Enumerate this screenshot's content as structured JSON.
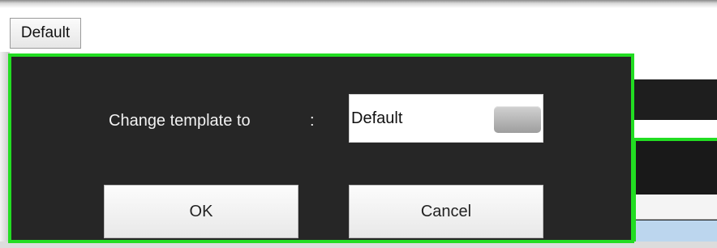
{
  "toolbar": {
    "template_button_label": "Default"
  },
  "dialog": {
    "label": "Change template to",
    "separator": ":",
    "selected_template": "Default",
    "ok_label": "OK",
    "cancel_label": "Cancel"
  },
  "colors": {
    "dialog_background": "#262626",
    "dialog_border": "#22dd22",
    "button_face": "#f0f0f0",
    "selection_row": "#bcd6ee"
  }
}
